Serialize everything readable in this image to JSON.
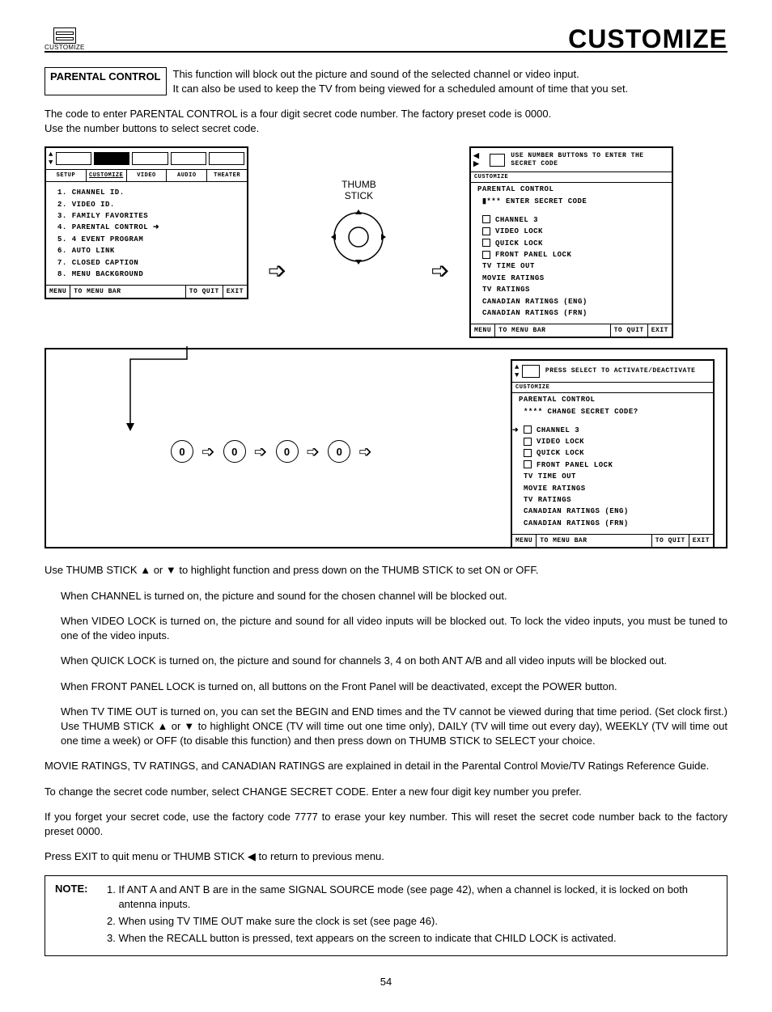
{
  "header": {
    "iconLabel": "CUSTOMIZE",
    "title": "CUSTOMIZE"
  },
  "section": {
    "boxLabel": "PARENTAL CONTROL",
    "introLine1": "This function will block out the picture and sound of the selected channel or video input.",
    "introLine2": "It can also be used to keep the TV from being viewed for a scheduled amount of time that you set.",
    "code1": "The code to enter PARENTAL CONTROL is a four digit secret code number.  The factory preset code is 0000.",
    "code2": "Use the number buttons to select secret code."
  },
  "osd1": {
    "tabs": [
      "SETUP",
      "CUSTOMIZE",
      "VIDEO",
      "AUDIO",
      "THEATER"
    ],
    "items": [
      "1. CHANNEL ID.",
      "2. VIDEO ID.",
      "3. FAMILY FAVORITES",
      "4. PARENTAL CONTROL",
      "5. 4 EVENT PROGRAM",
      "6. AUTO LINK",
      "7. CLOSED CAPTION",
      "8. MENU BACKGROUND"
    ],
    "footMenu": "MENU",
    "footBar": "TO MENU BAR",
    "footQuit": "TO QUIT",
    "footExit": "EXIT"
  },
  "thumb": {
    "l1": "THUMB",
    "l2": "STICK"
  },
  "osd2": {
    "hint": "USE NUMBER BUTTONS TO ENTER THE SECRET CODE",
    "hdr": "PARENTAL CONTROL",
    "enter": "*** ENTER SECRET CODE",
    "items": [
      "CHANNEL 3",
      "VIDEO LOCK",
      "QUICK LOCK",
      "FRONT PANEL LOCK",
      "TV TIME OUT",
      "MOVIE RATINGS",
      "TV RATINGS",
      "CANADIAN RATINGS (ENG)",
      "CANADIAN RATINGS (FRN)"
    ],
    "footMenu": "MENU",
    "footBar": "TO MENU BAR",
    "footQuit": "TO QUIT",
    "footExit": "EXIT"
  },
  "digits": [
    "0",
    "0",
    "0",
    "0"
  ],
  "osd3": {
    "hint": "PRESS SELECT TO ACTIVATE/DEACTIVATE",
    "hdr": "PARENTAL CONTROL",
    "change": "**** CHANGE SECRET CODE?",
    "items": [
      "CHANNEL 3",
      "VIDEO LOCK",
      "QUICK LOCK",
      "FRONT PANEL LOCK",
      "TV TIME OUT",
      "MOVIE RATINGS",
      "TV RATINGS",
      "CANADIAN RATINGS (ENG)",
      "CANADIAN RATINGS (FRN)"
    ],
    "footMenu": "MENU",
    "footBar": "TO MENU BAR",
    "footQuit": "TO QUIT",
    "footExit": "EXIT"
  },
  "body": {
    "p1": "Use THUMB STICK ▲ or ▼ to highlight function and press down on the THUMB STICK to set ON or OFF.",
    "p2": "When CHANNEL is turned on, the picture and sound for the chosen channel will be blocked out.",
    "p3": "When VIDEO LOCK is turned on, the picture and sound for all video inputs will be blocked out. To lock the video inputs, you must be tuned to one of the video inputs.",
    "p4": "When QUICK LOCK is turned on, the picture and sound for channels 3, 4 on both ANT A/B and all video inputs will be blocked out.",
    "p5": "When FRONT PANEL LOCK is turned on, all buttons on the Front Panel will be deactivated, except the POWER button.",
    "p6": "When TV TIME OUT is turned on, you can set the BEGIN and END times and the TV cannot be viewed during that time period. (Set clock first.) Use THUMB STICK ▲ or ▼ to highlight ONCE (TV will time out one time only), DAILY (TV will time out every day), WEEKLY (TV will time out one time a week) or OFF (to disable this function) and then press down on THUMB STICK to SELECT your choice.",
    "p7": "MOVIE RATINGS, TV RATINGS, and CANADIAN RATINGS are explained in detail in the Parental Control Movie/TV Ratings Reference Guide.",
    "p8": "To change the secret code number, select CHANGE SECRET CODE.  Enter a new four digit key number you prefer.",
    "p9": "If you forget your secret code, use the factory code 7777 to erase your key number. This will reset the secret code number back to the factory preset 0000.",
    "p10": "Press EXIT to quit menu or THUMB STICK ◀ to return to previous menu."
  },
  "note": {
    "label": "NOTE:",
    "n1": "If ANT A and ANT B are in the same SIGNAL SOURCE mode (see page 42), when a channel is locked, it is locked on both antenna inputs.",
    "n2": "When using TV TIME OUT make sure the clock is set (see page 46).",
    "n3": "When the RECALL button is pressed, text appears on the screen to indicate that CHILD LOCK is activated."
  },
  "page": "54"
}
